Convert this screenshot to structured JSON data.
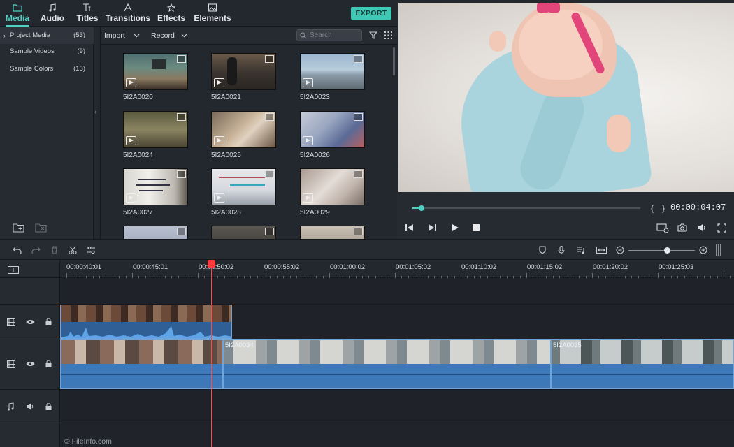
{
  "nav": {
    "tabs": [
      {
        "label": "Media",
        "icon": "folder-icon"
      },
      {
        "label": "Audio",
        "icon": "music-note-icon"
      },
      {
        "label": "Titles",
        "icon": "text-icon"
      },
      {
        "label": "Transitions",
        "icon": "transition-icon"
      },
      {
        "label": "Effects",
        "icon": "effects-icon"
      },
      {
        "label": "Elements",
        "icon": "image-icon"
      }
    ],
    "active": "Media",
    "export_label": "EXPORT"
  },
  "sidebar": {
    "items": [
      {
        "label": "Project Media",
        "count": "(53)"
      },
      {
        "label": "Sample Videos",
        "count": "(9)"
      },
      {
        "label": "Sample Colors",
        "count": "(15)"
      }
    ]
  },
  "media_toolbar": {
    "import_label": "Import",
    "record_label": "Record",
    "search_placeholder": "Search"
  },
  "media": {
    "items": [
      {
        "name": "5I2A0020"
      },
      {
        "name": "5I2A0021"
      },
      {
        "name": "5I2A0023"
      },
      {
        "name": "5I2A0024"
      },
      {
        "name": "5I2A0025"
      },
      {
        "name": "5I2A0026"
      },
      {
        "name": "5I2A0027"
      },
      {
        "name": "5I2A0028"
      },
      {
        "name": "5I2A0029"
      }
    ]
  },
  "preview": {
    "timecode": "00:00:04:07",
    "progress": 0.04
  },
  "timeline": {
    "ruler": [
      "00:00:40:01",
      "00:00:45:01",
      "00:00:50:02",
      "00:00:55:02",
      "00:01:00:02",
      "00:01:05:02",
      "00:01:10:02",
      "00:01:15:02",
      "00:01:20:02",
      "00:01:25:03"
    ],
    "clips": [
      {
        "name": "5I2A0034"
      },
      {
        "name": "5I2A0035"
      }
    ],
    "zoom_level": 0.58
  },
  "watermark": "© FileInfo.com",
  "colors": {
    "accent": "#4fd1c5",
    "clip": "#3d78b8",
    "playhead": "#ff3b3b"
  }
}
